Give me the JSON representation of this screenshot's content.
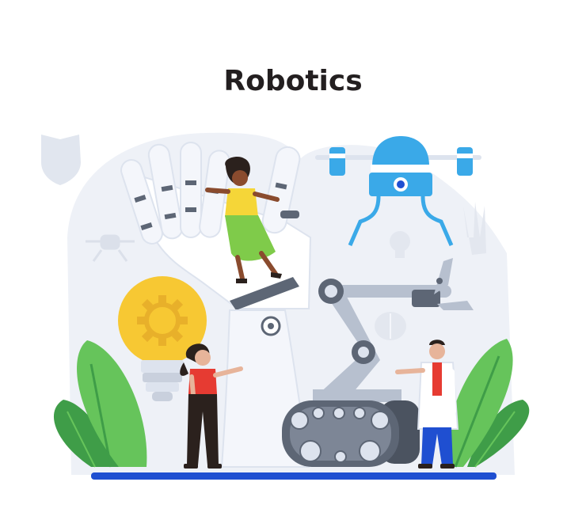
{
  "heading": {
    "title": "Robotics"
  },
  "colors": {
    "background": "#ffffff",
    "backdrop": "#eef1f7",
    "robot_light": "#f4f6fb",
    "robot_mid": "#dde3ee",
    "robot_dark": "#5d6675",
    "accent_blue": "#3aa9e8",
    "deep_blue": "#1f4fd1",
    "bulb_yellow": "#f7c833",
    "leaf_green": "#66c45b",
    "leaf_dark": "#3f9d48",
    "skin": "#8a4b2e",
    "shirt_red": "#e63b32",
    "shirt_yellow": "#f5d638",
    "skirt_green": "#7fcb4a"
  },
  "icons": [
    "shield-icon",
    "drone-icon",
    "lightbulb-gear-icon",
    "brain-icon",
    "hand-icon"
  ]
}
